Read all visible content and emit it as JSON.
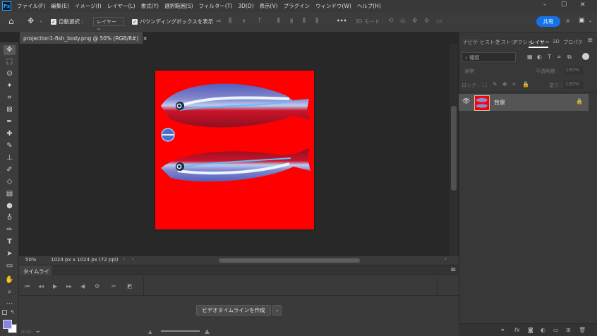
{
  "app": {
    "logo_text": "Ps"
  },
  "menu": [
    "ファイル(F)",
    "編集(E)",
    "イメージ(I)",
    "レイヤー(L)",
    "書式(Y)",
    "選択範囲(S)",
    "フィルター(T)",
    "3D(D)",
    "表示(V)",
    "プラグイン",
    "ウィンドウ(W)",
    "ヘルプ(H)"
  ],
  "window_controls": {
    "minimize": "–",
    "maximize": "☐",
    "close": "✕"
  },
  "options": {
    "auto_select_label": "自動選択 :",
    "auto_select_value": "レイヤー",
    "bounding_box_label": "バウンディングボックスを表示",
    "more": "•••",
    "mode_3d_label": "3D モード :",
    "share_label": "共有"
  },
  "document_tab": {
    "title": "projection1-fish_body.png @ 50% (RGB/8#)",
    "close": "×"
  },
  "status": {
    "zoom": "50%",
    "doc_info": "1024 px x 1024 px (72 ppi)"
  },
  "timeline": {
    "tab_label": "タイムライン",
    "create_button": "ビデオタイムラインを作成"
  },
  "panel": {
    "tabs": [
      "ナビゲ",
      "ヒストグ",
      "ヒストリ",
      "アクショ",
      "レイヤー",
      "3D",
      "プロパテ"
    ],
    "search_placeholder": "種類",
    "blend_mode": "通常",
    "opacity_label": "不透明度 :",
    "opacity_value": "100%",
    "lock_label": "ロック :",
    "fill_label": "塗り :",
    "fill_value": "100%",
    "layer_name": "背景"
  },
  "colors": {
    "canvas_bg": "#ff0000",
    "accent": "#1473e6"
  }
}
